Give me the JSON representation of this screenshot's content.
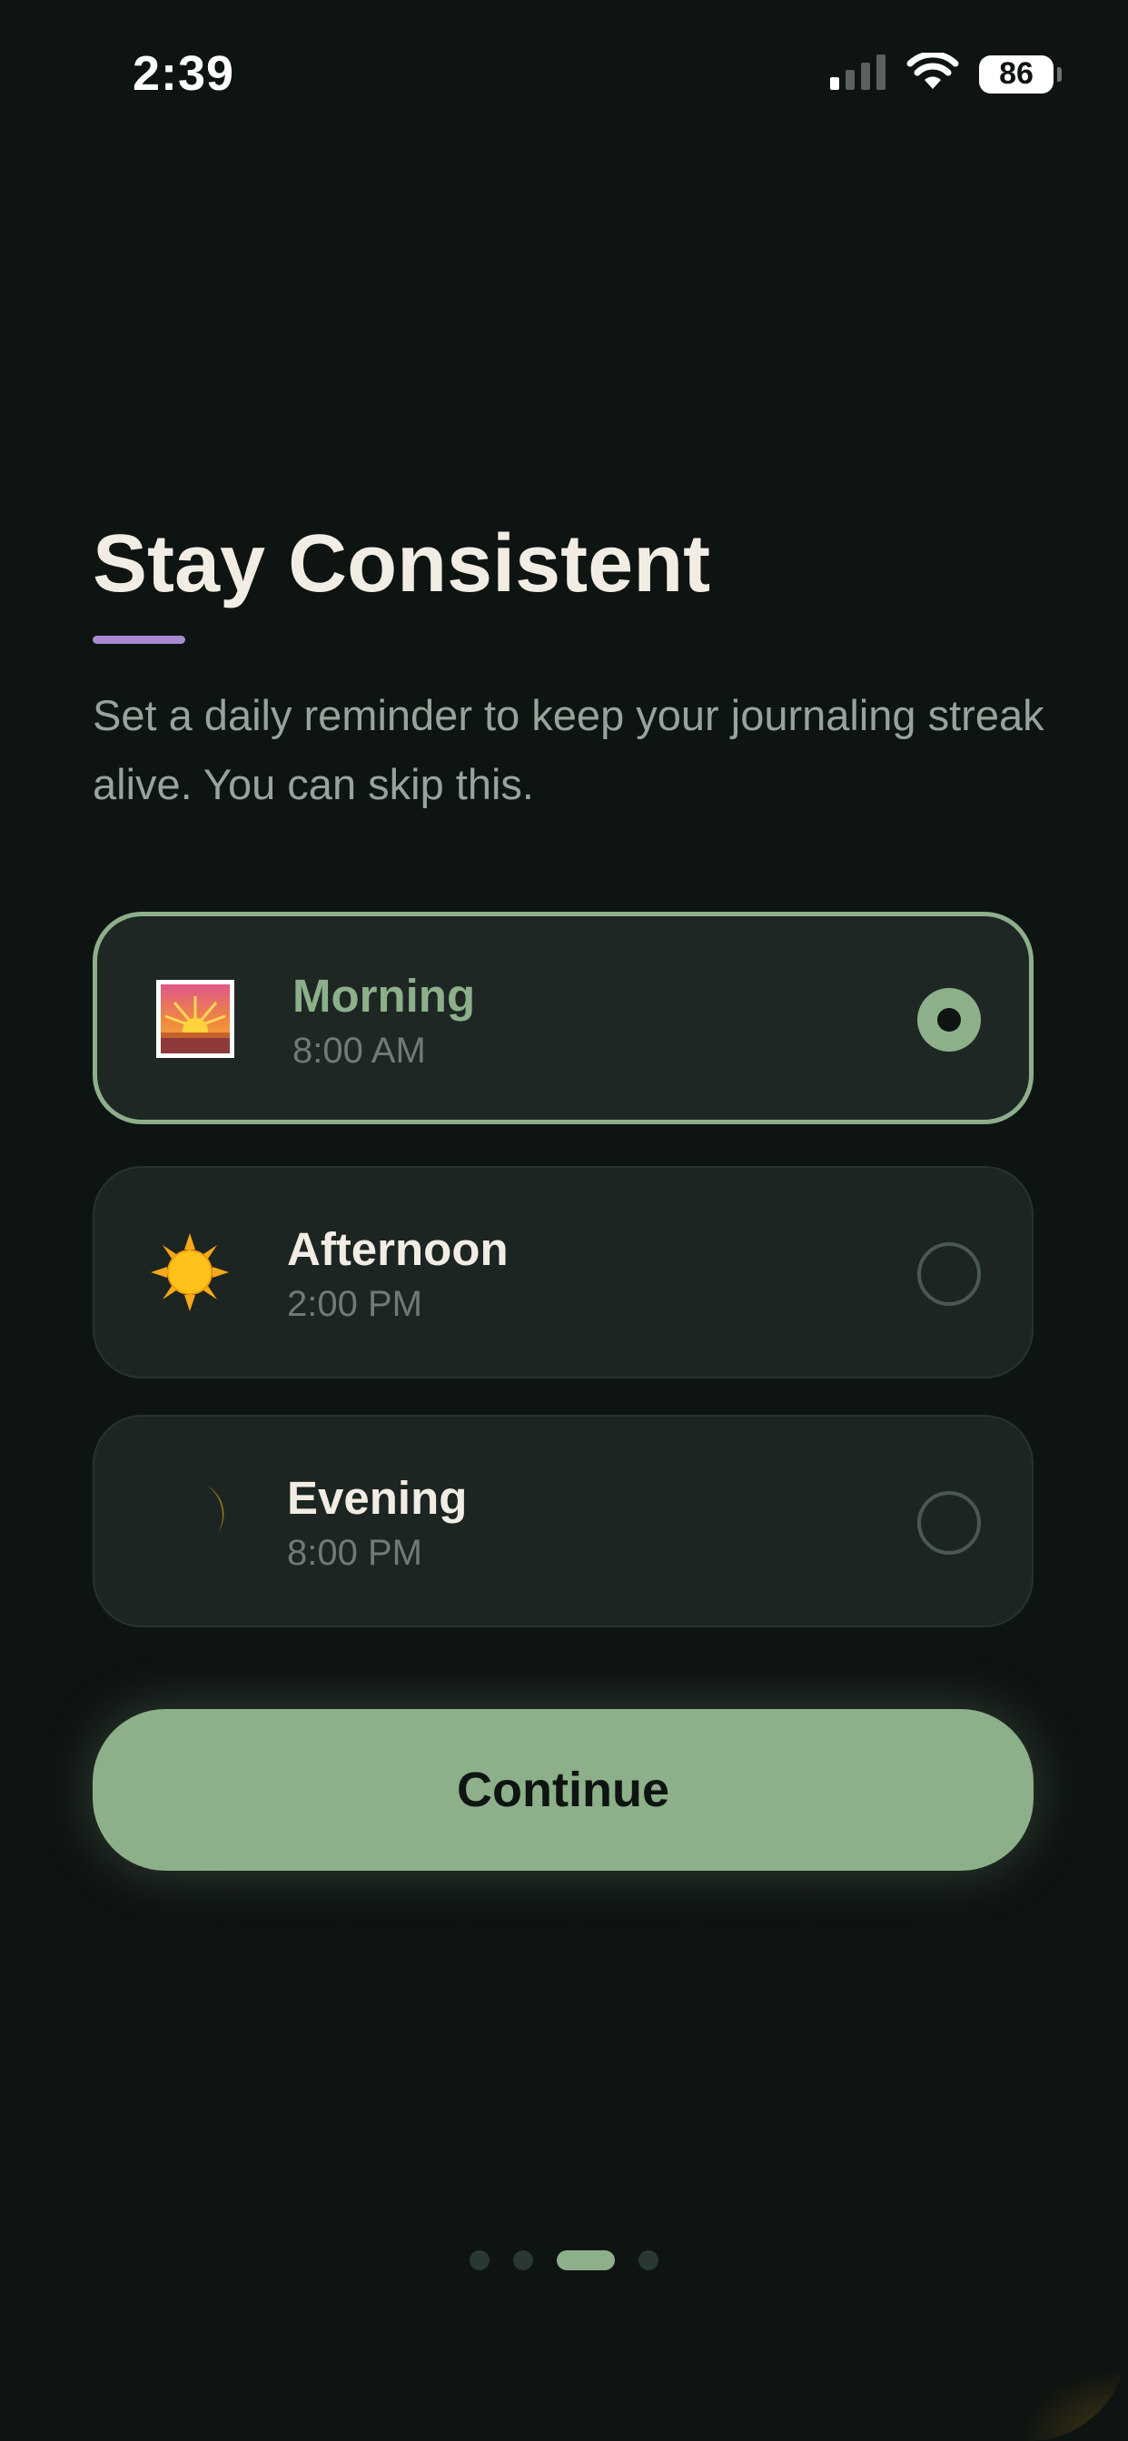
{
  "status_bar": {
    "time": "2:39",
    "battery": "86"
  },
  "onboarding": {
    "title": "Stay Consistent",
    "subtitle": "Set a daily reminder to keep your journaling streak alive. You can skip this.",
    "options": [
      {
        "label": "Morning",
        "time": "8:00 AM",
        "icon": "sunrise-icon",
        "selected": true
      },
      {
        "label": "Afternoon",
        "time": "2:00 PM",
        "icon": "sun-icon",
        "selected": false
      },
      {
        "label": "Evening",
        "time": "8:00 PM",
        "icon": "crescent-moon-icon",
        "selected": false
      }
    ],
    "continue_label": "Continue",
    "pagination": {
      "total": 4,
      "current": 3
    }
  },
  "colors": {
    "background": "#0e1411",
    "accent": "#8db08b",
    "underline": "#a88ad0",
    "card": "#1c2522",
    "title": "#f2ede4",
    "subtitle": "#98a39c"
  }
}
